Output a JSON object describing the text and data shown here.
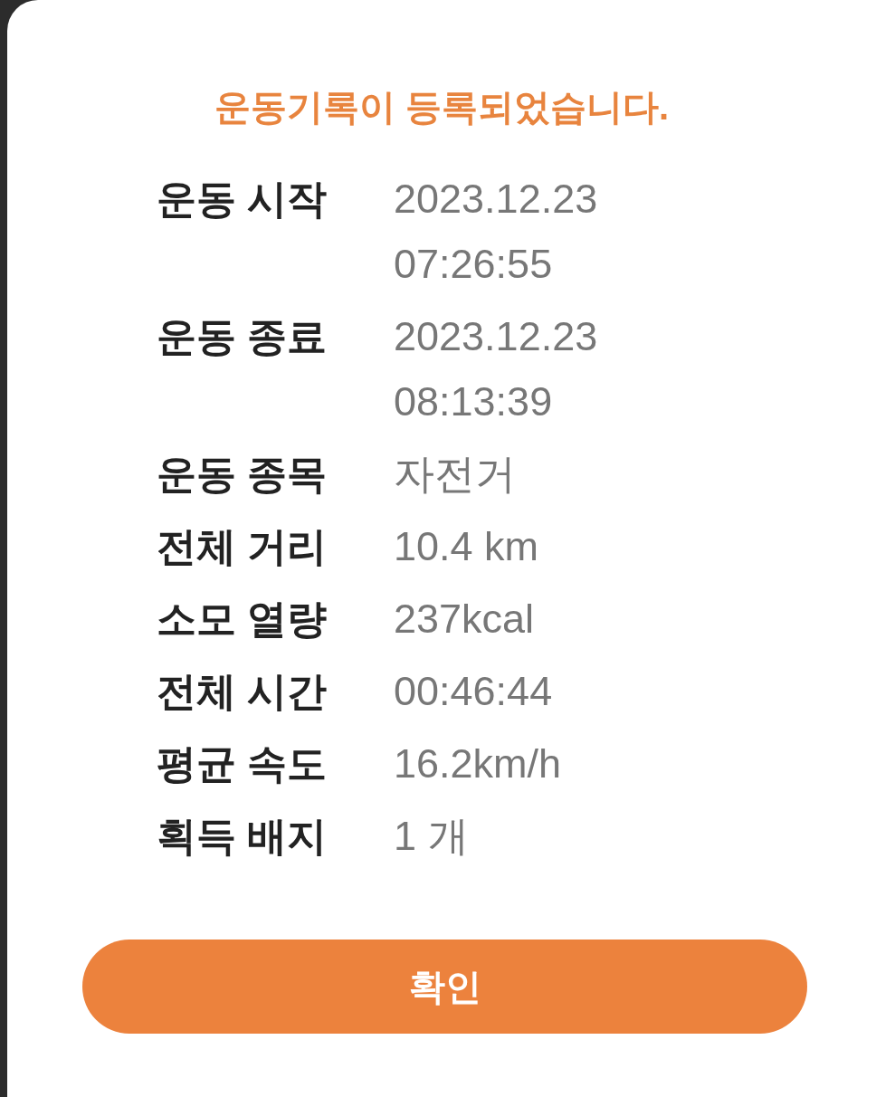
{
  "title": "운동기록이 등록되었습니다.",
  "rows": [
    {
      "label": "운동 시작",
      "value": [
        "2023.12.23",
        "07:26:55"
      ]
    },
    {
      "label": "운동 종료",
      "value": [
        "2023.12.23",
        "08:13:39"
      ]
    },
    {
      "label": "운동 종목",
      "value": [
        "자전거"
      ]
    },
    {
      "label": "전체 거리",
      "value": [
        "10.4 km"
      ]
    },
    {
      "label": "소모 열량",
      "value": [
        "237kcal"
      ]
    },
    {
      "label": "전체 시간",
      "value": [
        "00:46:44"
      ]
    },
    {
      "label": "평균 속도",
      "value": [
        "16.2km/h"
      ]
    },
    {
      "label": "획득 배지",
      "value": [
        "1 개"
      ]
    }
  ],
  "button": "확인"
}
